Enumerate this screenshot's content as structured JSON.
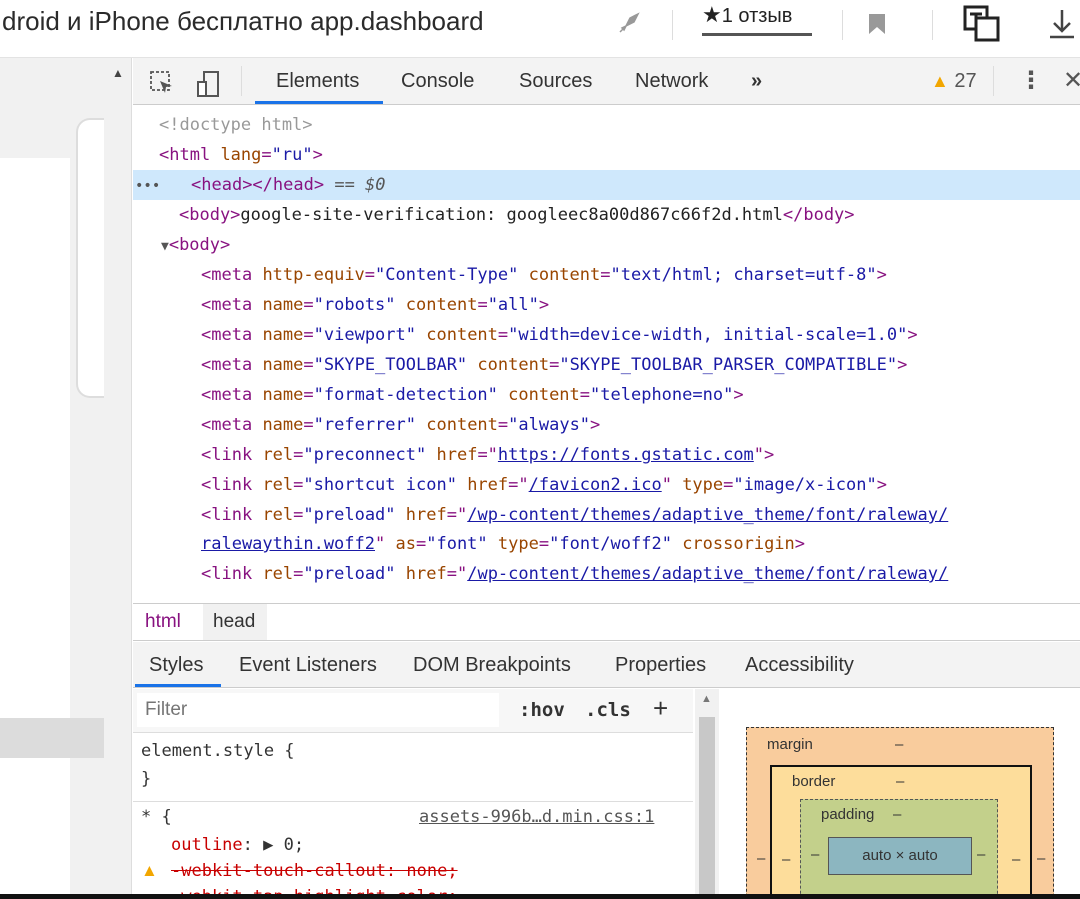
{
  "browser": {
    "page_title": "droid и iPhone бесплатно app.dashboard",
    "review_star": "★",
    "review_label": "1 отзыв"
  },
  "devtools": {
    "tabs": [
      "Elements",
      "Console",
      "Sources",
      "Network"
    ],
    "more_tabs": "»",
    "warning_count": "27",
    "elements": {
      "doctype": "<!doctype html>",
      "html_open_tag": "<html",
      "html_lang_attr": "lang",
      "html_lang_val": "\"ru\"",
      "head_line": "<head></head>",
      "head_eq": "== ",
      "head_dollar": "$0",
      "body1_open": "<body>",
      "body1_text": "google-site-verification: googleec8a00d867c66f2d.html",
      "body1_close": "</body>",
      "body2_open": "<body>",
      "meta_rows": [
        {
          "a1": "http-equiv",
          "v1": "\"Content-Type\"",
          "a2": "content",
          "v2": "\"text/html; charset=utf-8\""
        },
        {
          "a1": "name",
          "v1": "\"robots\"",
          "a2": "content",
          "v2": "\"all\""
        },
        {
          "a1": "name",
          "v1": "\"viewport\"",
          "a2": "content",
          "v2": "\"width=device-width, initial-scale=1.0\""
        },
        {
          "a1": "name",
          "v1": "\"SKYPE_TOOLBAR\"",
          "a2": "content",
          "v2": "\"SKYPE_TOOLBAR_PARSER_COMPATIBLE\""
        },
        {
          "a1": "name",
          "v1": "\"format-detection\"",
          "a2": "content",
          "v2": "\"telephone=no\""
        },
        {
          "a1": "name",
          "v1": "\"referrer\"",
          "a2": "content",
          "v2": "\"always\""
        }
      ],
      "link1": {
        "rel": "\"preconnect\"",
        "href": "https://fonts.gstatic.com"
      },
      "link2": {
        "rel": "\"shortcut icon\"",
        "href": "/favicon2.ico",
        "type": "\"image/x-icon\""
      },
      "link3": {
        "rel": "\"preload\"",
        "href": "/wp-content/themes/adaptive_theme/font/raleway/",
        "href_cont": "ralewaythin.woff2",
        "as": "\"font\"",
        "type": "\"font/woff2\"",
        "extra": "crossorigin"
      },
      "link4": {
        "rel": "\"preload\"",
        "href": "/wp-content/themes/adaptive_theme/font/raleway/"
      }
    },
    "breadcrumb": [
      "html",
      "head"
    ],
    "lower_tabs": [
      "Styles",
      "Event Listeners",
      "DOM Breakpoints",
      "Properties",
      "Accessibility"
    ],
    "styles": {
      "filter_placeholder": "Filter",
      "hov": ":hov",
      "cls": ".cls",
      "plus": "+",
      "element_style": "element.style {",
      "element_style_close": "}",
      "rule2_selector": "* {",
      "rule2_source": "assets-996b…d.min.css:1",
      "outline_name": "outline",
      "outline_value": ": ▶ 0;",
      "callout": "-webkit-touch-callout: none;",
      "tap_highlight": "-webkit-tap-highlight-color:"
    },
    "boxmodel": {
      "margin_label": "margin",
      "border_label": "border",
      "padding_label": "padding",
      "dash": "–",
      "content": "auto × auto"
    }
  }
}
